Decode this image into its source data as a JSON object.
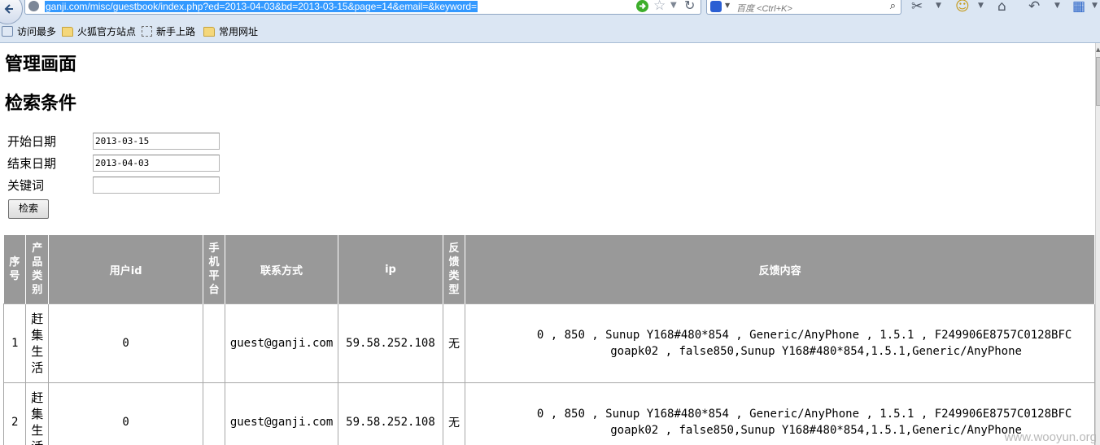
{
  "browser": {
    "url": "ganji.com/misc/guestbook/index.php?ed=2013-04-03&bd=2013-03-15&page=14&email=&keyword=",
    "search_placeholder": "百度 <Ctrl+K>",
    "bookmarks": [
      "访问最多",
      "火狐官方站点",
      "新手上路",
      "常用网址"
    ]
  },
  "page": {
    "title": "管理画面",
    "subtitle": "检索条件"
  },
  "form": {
    "start_label": "开始日期",
    "start_value": "2013-03-15",
    "end_label": "结束日期",
    "end_value": "2013-04-03",
    "keyword_label": "关键词",
    "keyword_value": "",
    "search_button": "检索"
  },
  "table": {
    "headers": [
      "序号",
      "产品类别",
      "用户id",
      "手机平台",
      "联系方式",
      "ip",
      "反馈类型",
      "反馈内容"
    ],
    "rows": [
      {
        "index": "1",
        "product": "赶集生活",
        "user_id": "0",
        "platform": "",
        "contact": "guest@ganji.com",
        "ip": "59.58.252.108",
        "type": "无",
        "content_line1": "0 , 850 , Sunup Y168#480*854 , Generic/AnyPhone , 1.5.1 , F249906E8757C0128BFC",
        "content_line2": "goapk02 , false850,Sunup Y168#480*854,1.5.1,Generic/AnyPhone"
      },
      {
        "index": "2",
        "product": "赶集生活",
        "user_id": "0",
        "platform": "",
        "contact": "guest@ganji.com",
        "ip": "59.58.252.108",
        "type": "无",
        "content_line1": "0 , 850 , Sunup Y168#480*854 , Generic/AnyPhone , 1.5.1 , F249906E8757C0128BFC",
        "content_line2": "goapk02 , false850,Sunup Y168#480*854,1.5.1,Generic/AnyPhone"
      }
    ]
  },
  "watermark": "www.wooyun.org"
}
